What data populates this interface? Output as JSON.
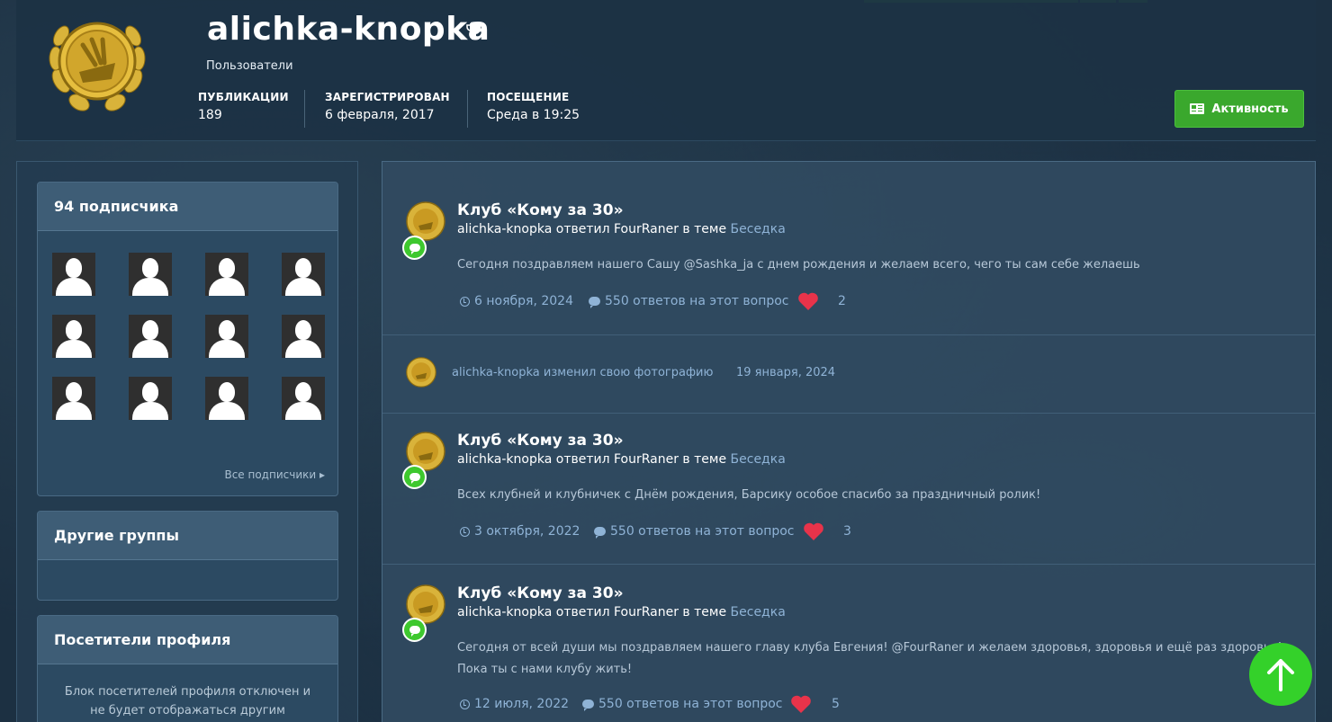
{
  "profile": {
    "username": "alichka-knopka",
    "group": "Пользователи",
    "stats": [
      {
        "label": "ПУБЛИКАЦИИ",
        "value": "189"
      },
      {
        "label": "ЗАРЕГИСТРИРОВАН",
        "value": "6 февраля, 2017"
      },
      {
        "label": "ПОСЕЩЕНИЕ",
        "value": "Среда в 19:25"
      }
    ],
    "activity_button": "Активность"
  },
  "sidebar": {
    "followers_title": "94 подписчика",
    "all_followers": "Все подписчики ▸",
    "other_groups_title": "Другие группы",
    "visitors_title": "Посетители профиля",
    "visitors_text": "Блок посетителей профиля отключен и не будет отображаться другим"
  },
  "feed": [
    {
      "title": "Клуб «Кому за 30»",
      "author": "alichka-knopka",
      "action": " ответил FourRaner в теме ",
      "topic": "Беседка",
      "body": "Сегодня поздравляем нашего Сашу @Sashka_ja с днем рождения и желаем всего, чего ты сам себе желаешь",
      "date": "6 ноября, 2024",
      "replies": "550 ответов на этот вопрос",
      "likes": "2"
    },
    {
      "title": "Клуб «Кому за 30»",
      "author": "alichka-knopka",
      "action": " ответил FourRaner в теме ",
      "topic": "Беседка",
      "body": "Всех клубней и клубничек с Днём рождения, Барсику особое спасибо за праздничный ролик!",
      "date": "3 октября, 2022",
      "replies": "550 ответов на этот вопрос",
      "likes": "3"
    },
    {
      "title": "Клуб «Кому за 30»",
      "author": "alichka-knopka",
      "action": " ответил FourRaner в теме ",
      "topic": "Беседка",
      "body": "Сегодня от всей души мы поздравляем нашего главу клуба Евгения! @FourRaner и желаем здоровья, здоровья и ещё раз здоровья!",
      "body2": "Пока ты с нами клубу жить!",
      "date": "12 июля, 2022",
      "replies": "550 ответов на этот вопрос",
      "likes": "5"
    }
  ],
  "photo_change": {
    "text": "alichka-knopka изменил свою фотографию",
    "date": "19 января, 2024"
  },
  "colors": {
    "accent_green": "#3aa82d",
    "link": "#8fb3d6",
    "heart": "#e8334a"
  }
}
